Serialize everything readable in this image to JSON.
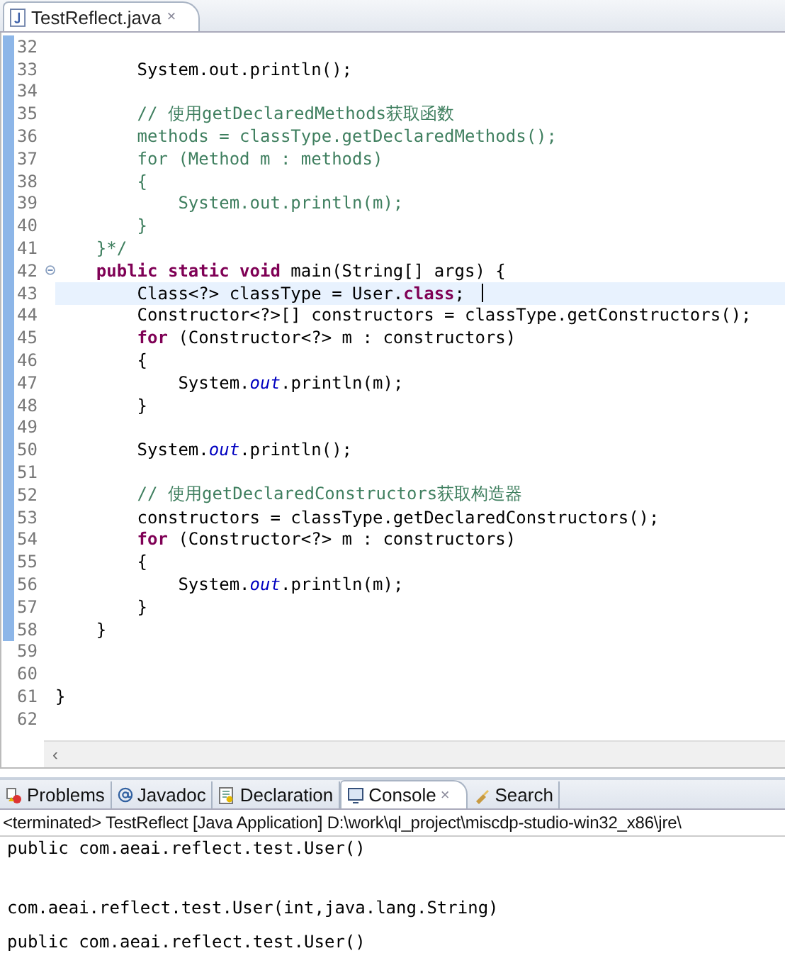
{
  "editor_tab": {
    "title": "TestReflect.java",
    "close": "×",
    "selected": true
  },
  "code_lines": [
    {
      "number": "32",
      "folded": false,
      "current": false,
      "changed": true
    },
    {
      "number": "33",
      "folded": false,
      "current": false,
      "changed": true,
      "tokens": [
        {
          "kind": "plain",
          "text": "        System.out.println();"
        }
      ]
    },
    {
      "number": "34",
      "folded": false,
      "current": false,
      "changed": true
    },
    {
      "number": "35",
      "folded": false,
      "current": false,
      "changed": true,
      "tokens": [
        {
          "kind": "comment",
          "text": "        // 使用getDeclaredMethods获取函数"
        }
      ]
    },
    {
      "number": "36",
      "folded": false,
      "current": false,
      "changed": true,
      "tokens": [
        {
          "kind": "comment",
          "text": "        methods = classType.getDeclaredMethods();"
        }
      ]
    },
    {
      "number": "37",
      "folded": false,
      "current": false,
      "changed": true,
      "tokens": [
        {
          "kind": "comment",
          "text": "        for (Method m : methods)"
        }
      ]
    },
    {
      "number": "38",
      "folded": false,
      "current": false,
      "changed": true,
      "tokens": [
        {
          "kind": "comment",
          "text": "        {"
        }
      ]
    },
    {
      "number": "39",
      "folded": false,
      "current": false,
      "changed": true,
      "tokens": [
        {
          "kind": "comment",
          "text": "            System.out.println(m);"
        }
      ]
    },
    {
      "number": "40",
      "folded": false,
      "current": false,
      "changed": true,
      "tokens": [
        {
          "kind": "comment",
          "text": "        }"
        }
      ]
    },
    {
      "number": "41",
      "folded": false,
      "current": false,
      "changed": true,
      "tokens": [
        {
          "kind": "comment",
          "text": "    }*/"
        }
      ]
    },
    {
      "number": "42",
      "folded": true,
      "current": false,
      "changed": true,
      "tokens": [
        {
          "kind": "keyword",
          "text": "    public static void"
        },
        {
          "kind": "plain",
          "text": " main(String[] args) {"
        }
      ]
    },
    {
      "number": "43",
      "folded": false,
      "current": true,
      "changed": true,
      "tokens": [
        {
          "kind": "plain",
          "text": "        Class<?> classType = User."
        },
        {
          "kind": "keyword",
          "text": "class"
        },
        {
          "kind": "plain",
          "text": ";"
        }
      ]
    },
    {
      "number": "44",
      "folded": false,
      "current": false,
      "changed": true,
      "tokens": [
        {
          "kind": "plain",
          "text": "        Constructor<?>[] constructors = classType.getConstructors();"
        }
      ]
    },
    {
      "number": "45",
      "folded": false,
      "current": false,
      "changed": true,
      "tokens": [
        {
          "kind": "keyword",
          "text": "        for"
        },
        {
          "kind": "plain",
          "text": " (Constructor<?> m : constructors)"
        }
      ]
    },
    {
      "number": "46",
      "folded": false,
      "current": false,
      "changed": true,
      "tokens": [
        {
          "kind": "plain",
          "text": "        {"
        }
      ]
    },
    {
      "number": "47",
      "folded": false,
      "current": false,
      "changed": true,
      "tokens": [
        {
          "kind": "plain",
          "text": "            System."
        },
        {
          "kind": "field",
          "text": "out"
        },
        {
          "kind": "plain",
          "text": ".println(m);"
        }
      ]
    },
    {
      "number": "48",
      "folded": false,
      "current": false,
      "changed": true,
      "tokens": [
        {
          "kind": "plain",
          "text": "        }"
        }
      ]
    },
    {
      "number": "49",
      "folded": false,
      "current": false,
      "changed": true
    },
    {
      "number": "50",
      "folded": false,
      "current": false,
      "changed": true,
      "tokens": [
        {
          "kind": "plain",
          "text": "        System."
        },
        {
          "kind": "field",
          "text": "out"
        },
        {
          "kind": "plain",
          "text": ".println();"
        }
      ]
    },
    {
      "number": "51",
      "folded": false,
      "current": false,
      "changed": true
    },
    {
      "number": "52",
      "folded": false,
      "current": false,
      "changed": true,
      "tokens": [
        {
          "kind": "comment",
          "text": "        // 使用getDeclaredConstructors获取构造器"
        }
      ]
    },
    {
      "number": "53",
      "folded": false,
      "current": false,
      "changed": true,
      "tokens": [
        {
          "kind": "plain",
          "text": "        constructors = classType.getDeclaredConstructors();"
        }
      ]
    },
    {
      "number": "54",
      "folded": false,
      "current": false,
      "changed": true,
      "tokens": [
        {
          "kind": "keyword",
          "text": "        for"
        },
        {
          "kind": "plain",
          "text": " (Constructor<?> m : constructors)"
        }
      ]
    },
    {
      "number": "55",
      "folded": false,
      "current": false,
      "changed": true,
      "tokens": [
        {
          "kind": "plain",
          "text": "        {"
        }
      ]
    },
    {
      "number": "56",
      "folded": false,
      "current": false,
      "changed": true,
      "tokens": [
        {
          "kind": "plain",
          "text": "            System."
        },
        {
          "kind": "field",
          "text": "out"
        },
        {
          "kind": "plain",
          "text": ".println(m);"
        }
      ]
    },
    {
      "number": "57",
      "folded": false,
      "current": false,
      "changed": true,
      "tokens": [
        {
          "kind": "plain",
          "text": "        }"
        }
      ]
    },
    {
      "number": "58",
      "folded": false,
      "current": false,
      "changed": true,
      "tokens": [
        {
          "kind": "plain",
          "text": "    }"
        }
      ]
    },
    {
      "number": "59",
      "folded": false,
      "current": false,
      "changed": false
    },
    {
      "number": "60",
      "folded": false,
      "current": false,
      "changed": false
    },
    {
      "number": "61",
      "folded": false,
      "current": false,
      "changed": false,
      "tokens": [
        {
          "kind": "plain",
          "text": "}"
        }
      ]
    },
    {
      "number": "62",
      "folded": false,
      "current": false,
      "changed": false
    }
  ],
  "scroll_left": "‹",
  "view_tabs": [
    {
      "label": "Problems",
      "selected": false
    },
    {
      "label": "Javadoc",
      "selected": false
    },
    {
      "label": "Declaration",
      "selected": false
    },
    {
      "label": "Console",
      "selected": true,
      "close": "×"
    },
    {
      "label": "Search",
      "selected": false
    }
  ],
  "console": {
    "header": "<terminated> TestReflect [Java Application] D:\\work\\ql_project\\miscdp-studio-win32_x86\\jre\\",
    "lines": [
      {
        "text": "public com.aeai.reflect.test.User()",
        "blank_before": false
      },
      {
        "text": "com.aeai.reflect.test.User(int,java.lang.String)",
        "blank_before": true
      },
      {
        "text": "public com.aeai.reflect.test.User()",
        "blank_before": false
      }
    ]
  }
}
